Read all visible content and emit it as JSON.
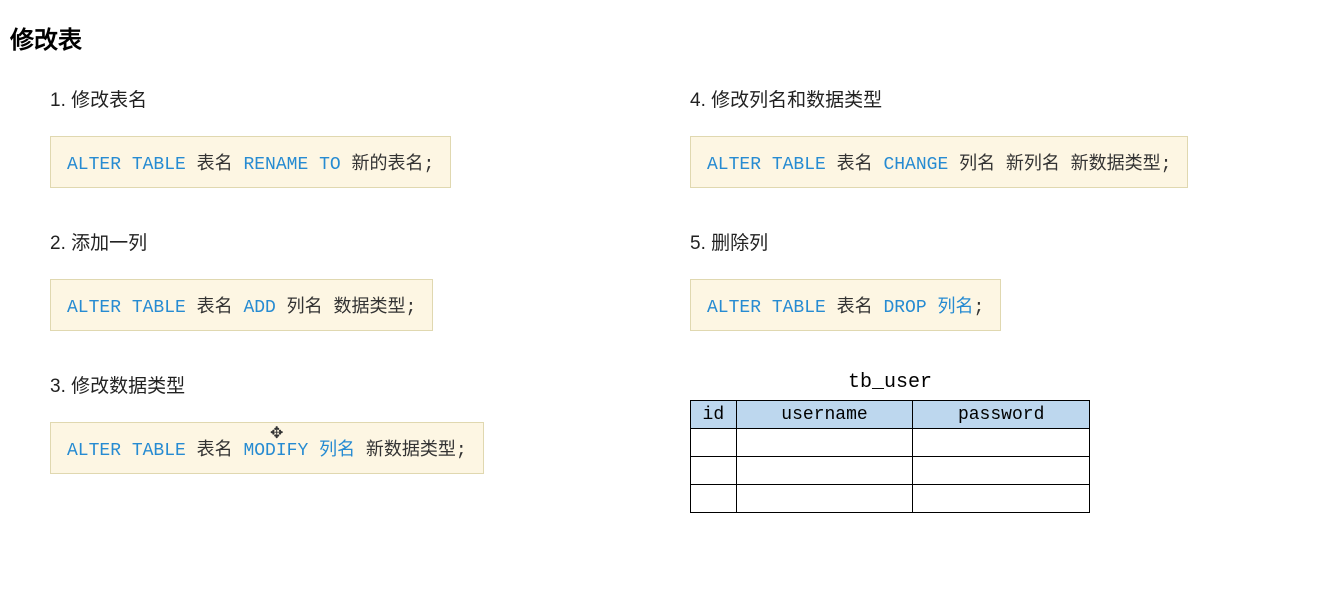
{
  "title": "修改表",
  "items": [
    {
      "num": "1.",
      "label": "修改表名",
      "tokens": [
        {
          "t": "ALTER",
          "c": "kw"
        },
        {
          "t": " ",
          "c": "kw"
        },
        {
          "t": "TABLE",
          "c": "kw"
        },
        {
          "t": " 表名 ",
          "c": "plain"
        },
        {
          "t": "RENAME",
          "c": "kw"
        },
        {
          "t": " ",
          "c": "kw"
        },
        {
          "t": "TO",
          "c": "kw"
        },
        {
          "t": " 新的表名;",
          "c": "plain"
        }
      ]
    },
    {
      "num": "2.",
      "label": "添加一列",
      "tokens": [
        {
          "t": "ALTER",
          "c": "kw"
        },
        {
          "t": " ",
          "c": "kw"
        },
        {
          "t": "TABLE",
          "c": "kw"
        },
        {
          "t": " 表名 ",
          "c": "plain"
        },
        {
          "t": "ADD",
          "c": "kw"
        },
        {
          "t": " 列名 数据类型;",
          "c": "plain"
        }
      ]
    },
    {
      "num": "3.",
      "label": "修改数据类型",
      "tokens": [
        {
          "t": "ALTER",
          "c": "kw"
        },
        {
          "t": " ",
          "c": "kw"
        },
        {
          "t": "TABLE",
          "c": "kw"
        },
        {
          "t": " 表名 ",
          "c": "plain"
        },
        {
          "t": "MODIFY",
          "c": "kw"
        },
        {
          "t": " ",
          "c": "plain"
        },
        {
          "t": "列名",
          "c": "kw"
        },
        {
          "t": " 新数据类型;",
          "c": "plain"
        }
      ]
    },
    {
      "num": "4.",
      "label": "修改列名和数据类型",
      "tokens": [
        {
          "t": "ALTER",
          "c": "kw"
        },
        {
          "t": " ",
          "c": "kw"
        },
        {
          "t": "TABLE",
          "c": "kw"
        },
        {
          "t": " 表名 ",
          "c": "plain"
        },
        {
          "t": "CHANGE",
          "c": "kw"
        },
        {
          "t": " 列名 新列名 新数据类型;",
          "c": "plain"
        }
      ]
    },
    {
      "num": "5.",
      "label": "删除列",
      "tokens": [
        {
          "t": "ALTER",
          "c": "kw"
        },
        {
          "t": " ",
          "c": "kw"
        },
        {
          "t": "TABLE",
          "c": "kw"
        },
        {
          "t": " 表名 ",
          "c": "plain"
        },
        {
          "t": "DROP",
          "c": "kw"
        },
        {
          "t": " ",
          "c": "plain"
        },
        {
          "t": "列名",
          "c": "kw"
        },
        {
          "t": ";",
          "c": "plain"
        }
      ]
    }
  ],
  "table": {
    "title": "tb_user",
    "headers": [
      "id",
      "username",
      "password"
    ],
    "rows": 3
  },
  "cursor_glyph": "✥"
}
